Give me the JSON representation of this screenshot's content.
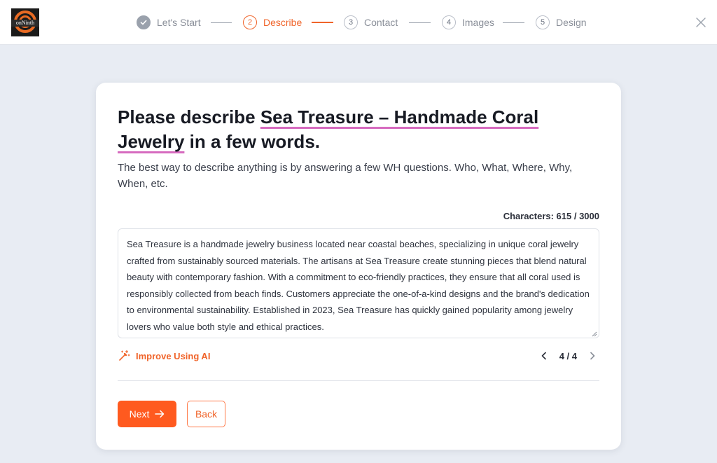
{
  "brand": {
    "logo_text": "onNinth"
  },
  "stepper": {
    "steps": [
      {
        "number": "1",
        "label": "Let's Start",
        "state": "done"
      },
      {
        "number": "2",
        "label": "Describe",
        "state": "active"
      },
      {
        "number": "3",
        "label": "Contact",
        "state": "pending"
      },
      {
        "number": "4",
        "label": "Images",
        "state": "pending"
      },
      {
        "number": "5",
        "label": "Design",
        "state": "pending"
      }
    ]
  },
  "form": {
    "heading_prefix": "Please describe ",
    "business_name": "Sea Treasure – Handmade Coral Jewelry",
    "heading_suffix": " in a few words.",
    "subtitle": "The best way to describe anything is by answering a few WH questions. Who, What, Where, Why, When, etc.",
    "char_count_label": "Characters: 615 / 3000",
    "description": "Sea Treasure is a handmade jewelry business located near coastal beaches, specializing in unique coral jewelry crafted from sustainably sourced materials. The artisans at Sea Treasure create stunning pieces that blend natural beauty with contemporary fashion. With a commitment to eco-friendly practices, they ensure that all coral used is responsibly collected from beach finds. Customers appreciate the one-of-a-kind designs and the brand's dedication to environmental sustainability. Established in 2023, Sea Treasure has quickly gained popularity among jewelry lovers who value both style and ethical practices.",
    "improve_label": "Improve Using AI",
    "pager_label": "4 / 4",
    "next_label": "Next",
    "back_label": "Back"
  },
  "colors": {
    "accent": "#ff5a1f",
    "accent_text": "#f0642a",
    "underline": "#d66bbf",
    "background": "#e8ecf3"
  },
  "icons": {
    "done_step": "check-icon",
    "close": "close-icon",
    "improve": "magic-wand-icon",
    "prev": "chevron-left-icon",
    "next_page": "chevron-right-icon",
    "next_button": "arrow-right-icon"
  }
}
